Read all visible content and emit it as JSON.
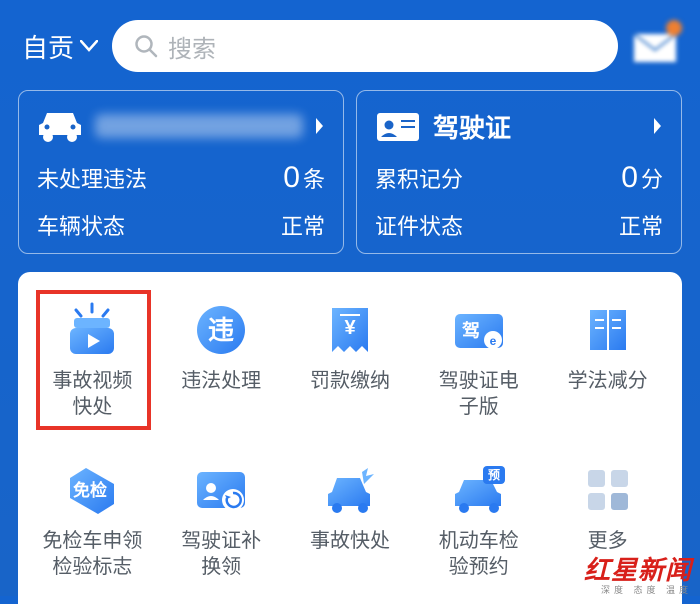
{
  "header": {
    "location": "自贡",
    "searchPlaceholder": "搜索"
  },
  "cards": {
    "vehicle": {
      "pendingLabel": "未处理违法",
      "pendingValue": "0",
      "pendingUnit": "条",
      "statusLabel": "车辆状态",
      "statusValue": "正常"
    },
    "license": {
      "title": "驾驶证",
      "pointsLabel": "累积记分",
      "pointsValue": "0",
      "pointsUnit": "分",
      "statusLabel": "证件状态",
      "statusValue": "正常"
    }
  },
  "services": [
    {
      "name": "accident-video",
      "label": "事故视频\n快处",
      "highlight": true
    },
    {
      "name": "violation-handle",
      "label": "违法处理"
    },
    {
      "name": "fine-payment",
      "label": "罚款缴纳"
    },
    {
      "name": "license-digital",
      "label": "驾驶证电\n子版"
    },
    {
      "name": "study-deduct",
      "label": "学法减分"
    },
    {
      "name": "exempt-inspection",
      "label": "免检车申领\n检验标志"
    },
    {
      "name": "license-reissue",
      "label": "驾驶证补\n换领"
    },
    {
      "name": "accident-quick",
      "label": "事故快处"
    },
    {
      "name": "inspection-appt",
      "label": "机动车检\n验预约"
    },
    {
      "name": "more",
      "label": "更多"
    }
  ],
  "watermark": {
    "main": "红星新闻",
    "sub": "深度 态度 温度"
  }
}
